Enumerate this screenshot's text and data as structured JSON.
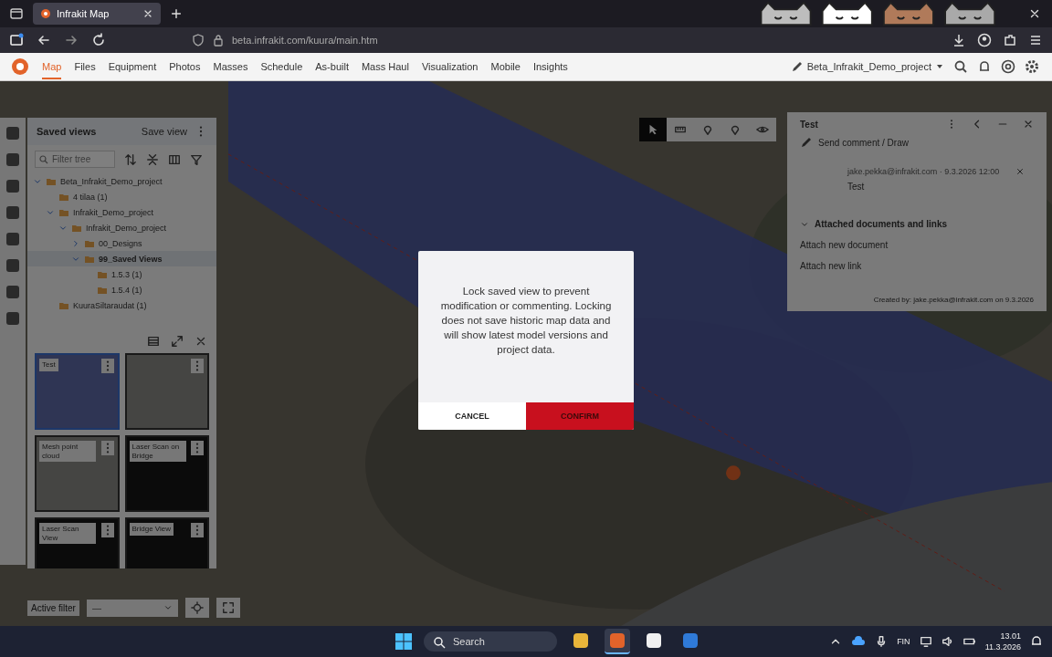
{
  "browser": {
    "tabs": [
      {
        "title": "Infrakit Map",
        "selected": true
      }
    ],
    "url": "beta.infrakit.com/kuura/main.htm"
  },
  "nav": {
    "items": [
      {
        "label": "Map",
        "selected": true
      },
      {
        "label": "Files",
        "selected": false
      },
      {
        "label": "Equipment",
        "selected": false
      },
      {
        "label": "Photos",
        "selected": false
      },
      {
        "label": "Masses",
        "selected": false
      },
      {
        "label": "Schedule",
        "selected": false
      },
      {
        "label": "As-built",
        "selected": false
      },
      {
        "label": "Mass Haul",
        "selected": false
      },
      {
        "label": "Visualization",
        "selected": false
      },
      {
        "label": "Mobile",
        "selected": false
      },
      {
        "label": "Insights",
        "selected": false
      }
    ],
    "project": "Beta_Infrakit_Demo_project"
  },
  "left_panel": {
    "title": "Saved views",
    "save_button": "Save view",
    "filter_placeholder": "Filter tree",
    "tree": [
      {
        "label": "Beta_Infrakit_Demo_project",
        "expanded": true,
        "selected": false,
        "children": [
          {
            "label": "4 tilaa (1)",
            "selected": false
          },
          {
            "label": "Infrakit_Demo_project",
            "expanded": true,
            "selected": false,
            "children": [
              {
                "label": "Infrakit_Demo_project",
                "expanded": true,
                "selected": false,
                "children": [
                  {
                    "label": "00_Designs",
                    "expanded": false,
                    "selected": false
                  },
                  {
                    "label": "99_Saved Views",
                    "expanded": true,
                    "selected": true,
                    "children": [
                      {
                        "label": "1.5.3 (1)",
                        "selected": false
                      },
                      {
                        "label": "1.5.4 (1)",
                        "selected": false
                      }
                    ]
                  }
                ]
              }
            ]
          },
          {
            "label": "KuuraSiltaraudat (1)",
            "selected": false
          }
        ]
      }
    ],
    "thumbnails": [
      {
        "label": "Test",
        "kind": "aerial",
        "selected": true
      },
      {
        "kind": "aerial",
        "selected": false
      },
      {
        "label": "Mesh point cloud",
        "kind": "aerial",
        "selected": false
      },
      {
        "label": "Laser Scan on Bridge",
        "kind": "dark",
        "selected": false
      },
      {
        "label": "Laser Scan View",
        "kind": "dark",
        "selected": false
      },
      {
        "label": "Bridge View",
        "kind": "dark",
        "selected": false
      }
    ]
  },
  "filter_bar": {
    "label": "Active filter",
    "value": "—"
  },
  "info_panel": {
    "title": "Test",
    "draw_link": "Send comment / Draw",
    "comment_author": "jake.pekka@infrakit.com · 9.3.2026 12:00",
    "comment_text": "Test",
    "section_title": "Attached documents and links",
    "section_expanded": true,
    "links": [
      "Attach new document",
      "Attach new link"
    ],
    "footer": "Created by: jake.pekka@infrakit.com on 9.3.2026"
  },
  "dialog": {
    "message": "Lock saved view to prevent modification or commenting. Locking does not save historic map data and will show latest model versions and project data.",
    "cancel": "CANCEL",
    "confirm": "CONFIRM"
  },
  "taskbar": {
    "search_placeholder": "Search",
    "apps": [
      {
        "kind": "folder",
        "selected": false
      },
      {
        "kind": "browser",
        "selected": true
      },
      {
        "kind": "chat",
        "selected": false
      },
      {
        "kind": "mail",
        "selected": false
      }
    ],
    "language": "FIN",
    "time": "13.01",
    "date": "11.3.2026"
  }
}
